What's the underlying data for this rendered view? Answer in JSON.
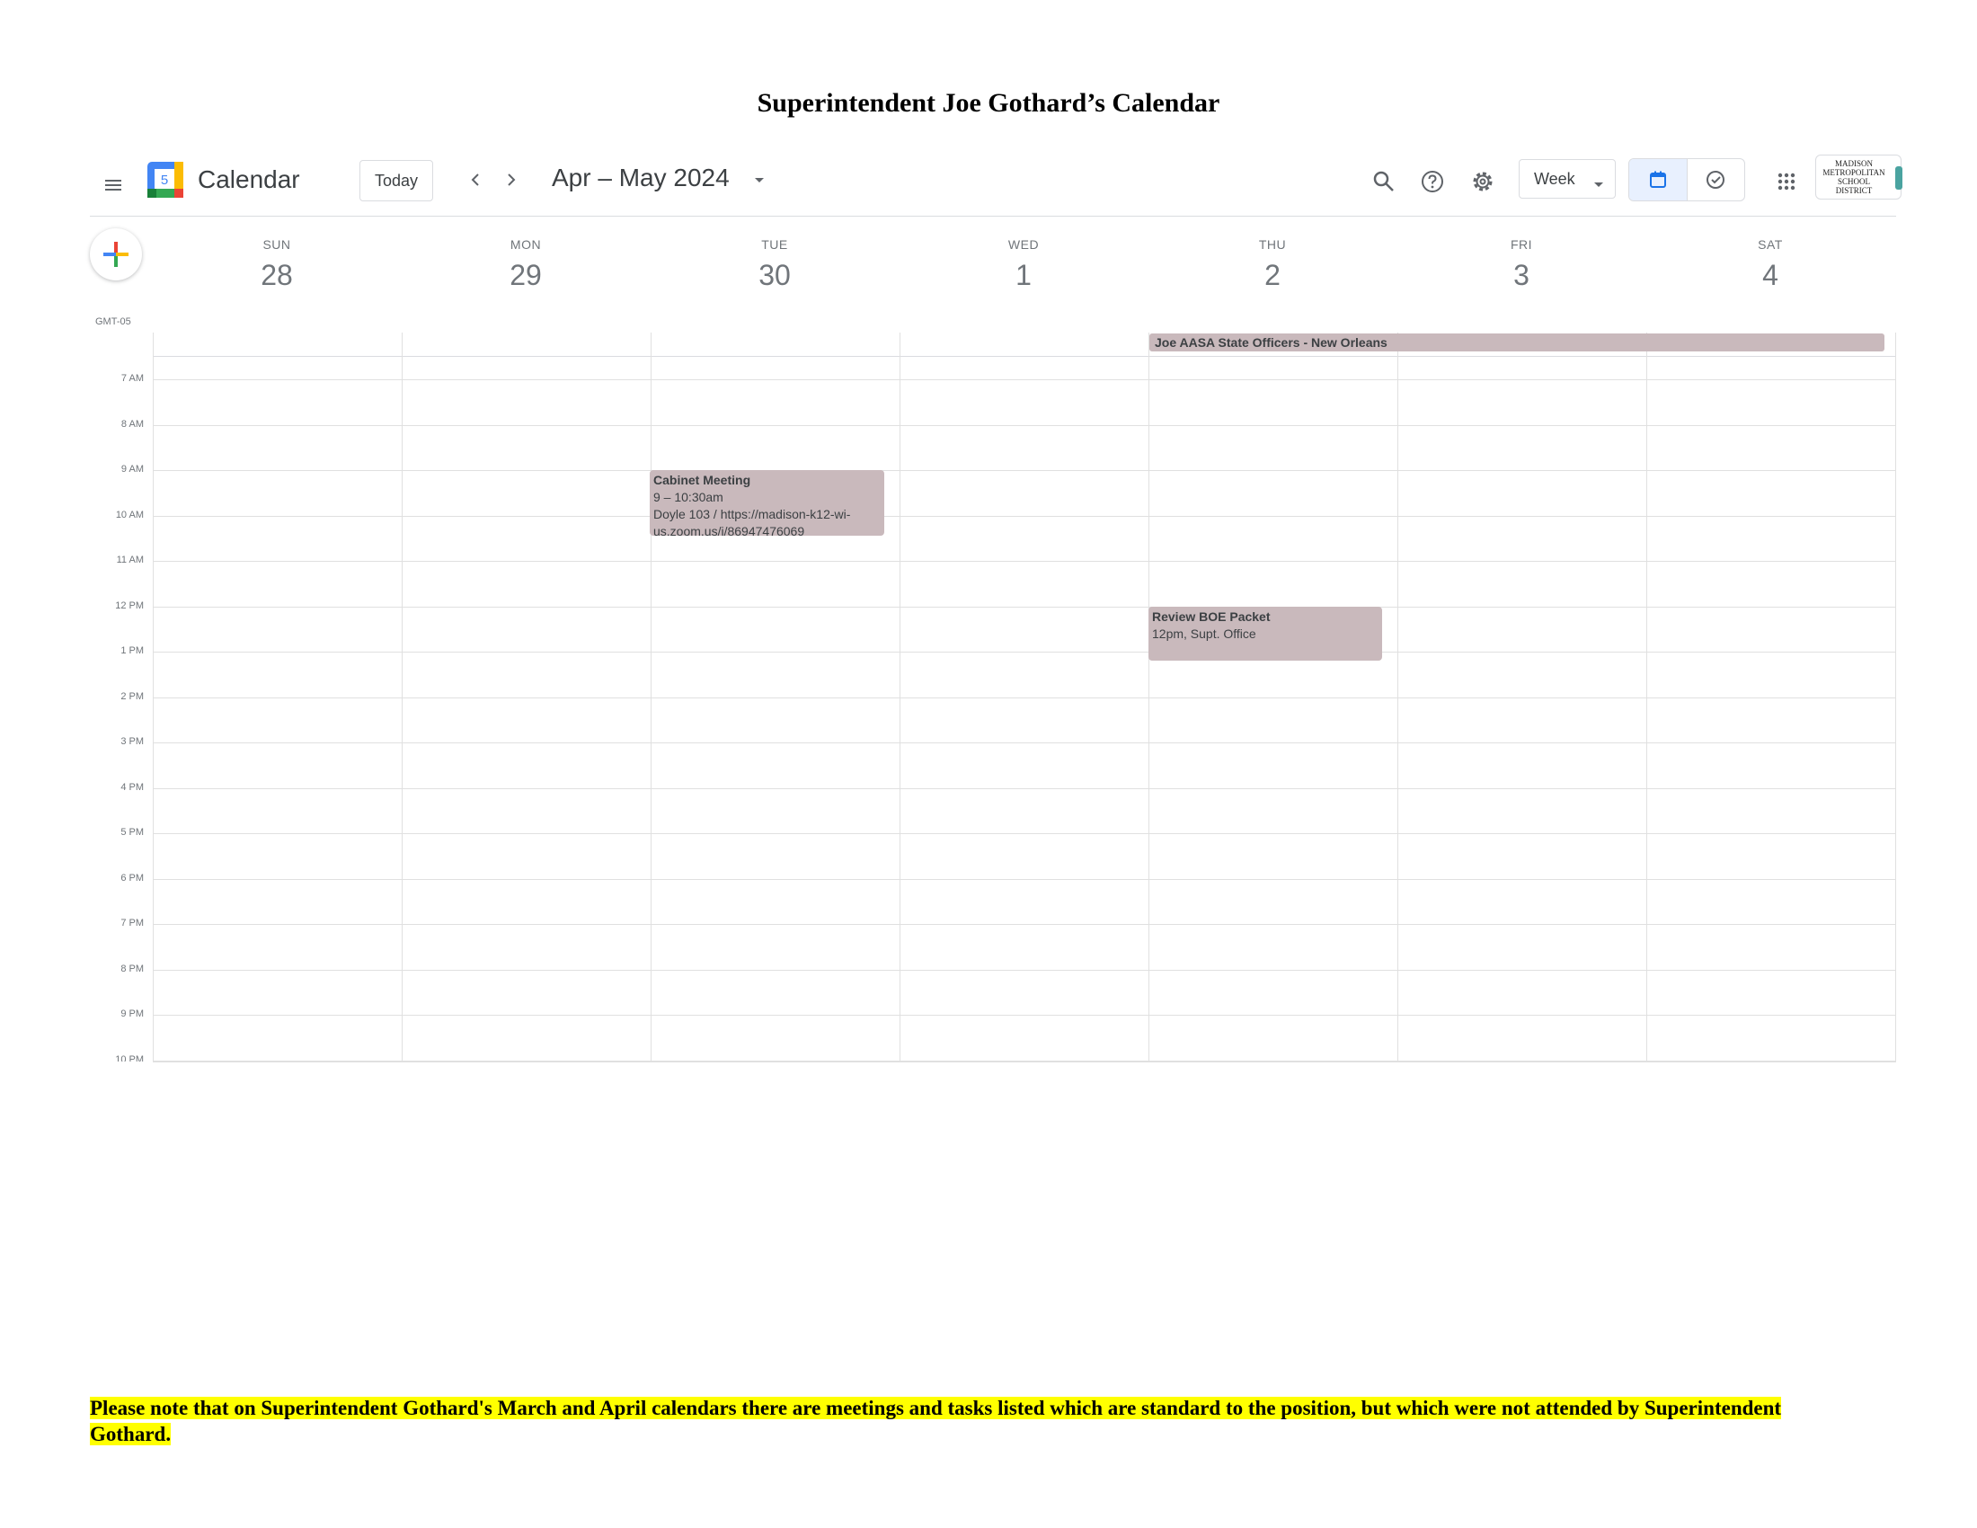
{
  "document": {
    "title": "Superintendent Joe Gothard’s Calendar",
    "footer_note": "Please note that on Superintendent Gothard's March and April calendars there are meetings and tasks listed which are standard to the position, but which were not attended by Superintendent Gothard."
  },
  "topbar": {
    "menu_icon": "hamburger-menu-icon",
    "logo_day": "5",
    "brand": "Calendar",
    "today_label": "Today",
    "date_range": "Apr – May 2024",
    "view_label": "Week",
    "org_logo_text": "MADISON METROPOLITAN SCHOOL DISTRICT"
  },
  "colors": {
    "event_bg": "#c9b9bc",
    "toggle_active_bg": "#e8f0fe",
    "highlight": "#ffff00",
    "accent_blue": "#1a73e8"
  },
  "week": {
    "timezone": "GMT-05",
    "days": [
      {
        "dow": "SUN",
        "date": "28"
      },
      {
        "dow": "MON",
        "date": "29"
      },
      {
        "dow": "TUE",
        "date": "30"
      },
      {
        "dow": "WED",
        "date": "1"
      },
      {
        "dow": "THU",
        "date": "2"
      },
      {
        "dow": "FRI",
        "date": "3"
      },
      {
        "dow": "SAT",
        "date": "4"
      }
    ],
    "hours": [
      "7 AM",
      "8 AM",
      "9 AM",
      "10 AM",
      "11 AM",
      "12 PM",
      "1 PM",
      "2 PM",
      "3 PM",
      "4 PM",
      "5 PM",
      "6 PM",
      "7 PM",
      "8 PM",
      "9 PM",
      "10 PM"
    ]
  },
  "events": {
    "allday": {
      "title": "Joe AASA State Officers - New Orleans"
    },
    "cabinet": {
      "title": "Cabinet Meeting",
      "time": "9 – 10:30am",
      "location": "Doyle 103 / https://madison-k12-wi-us.zoom.us/j/86947476069"
    },
    "review": {
      "title": "Review BOE Packet",
      "time": "12pm, Supt. Office"
    }
  }
}
